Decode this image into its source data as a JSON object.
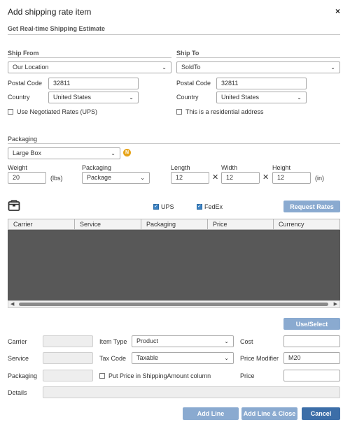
{
  "dialog": {
    "title": "Add shipping rate item",
    "close": "×"
  },
  "estimate": {
    "heading": "Get Real-time Shipping Estimate"
  },
  "ship_from": {
    "heading": "Ship From",
    "location": "Our Location",
    "postal_label": "Postal Code",
    "postal_value": "32811",
    "country_label": "Country",
    "country_value": "United States",
    "negotiated_label": "Use Negotiated Rates (UPS)"
  },
  "ship_to": {
    "heading": "Ship To",
    "location": "SoldTo",
    "postal_label": "Postal Code",
    "postal_value": "32811",
    "country_label": "Country",
    "country_value": "United States",
    "residential_label": "This is a residential address"
  },
  "packaging": {
    "heading": "Packaging",
    "box": "Large Box",
    "badge": "N",
    "weight_label": "Weight",
    "weight_value": "20",
    "weight_unit": "(lbs)",
    "packaging_label": "Packaging",
    "packaging_value": "Package",
    "length_label": "Length",
    "length_value": "12",
    "width_label": "Width",
    "width_value": "12",
    "height_label": "Height",
    "height_value": "12",
    "times": "✕",
    "dim_unit": "(in)"
  },
  "rates": {
    "ups_label": "UPS",
    "fedex_label": "FedEx",
    "request_button": "Request Rates",
    "columns": [
      "Carrier",
      "Service",
      "Packaging",
      "Price",
      "Currency"
    ],
    "use_select_button": "Use/Select"
  },
  "line_form": {
    "carrier_label": "Carrier",
    "service_label": "Service",
    "packaging_label": "Packaging",
    "details_label": "Details",
    "item_type_label": "Item Type",
    "item_type_value": "Product",
    "tax_code_label": "Tax Code",
    "tax_code_value": "Taxable",
    "put_price_label": "Put Price in ShippingAmount column",
    "cost_label": "Cost",
    "price_modifier_label": "Price Modifier",
    "price_modifier_value": "M20",
    "price_label": "Price"
  },
  "footer": {
    "add_line": "Add Line",
    "add_line_close": "Add Line & Close",
    "cancel": "Cancel"
  },
  "colors": {
    "accent": "#3c6ea8",
    "button_light": "#8aaad0",
    "grid_body": "#585858",
    "badge": "#e7a41a"
  }
}
